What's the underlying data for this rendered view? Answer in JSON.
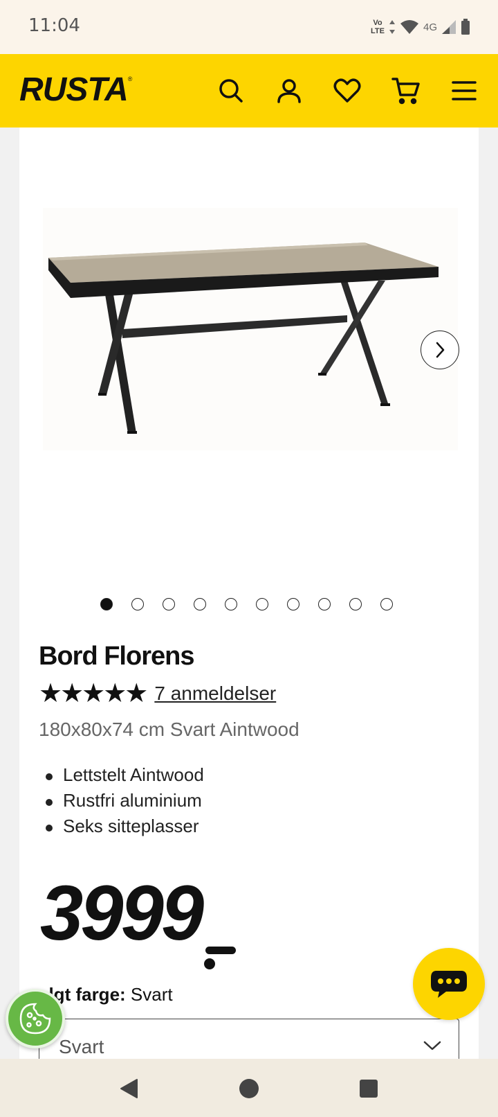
{
  "status_bar": {
    "time": "11:04",
    "volte": "Vo LTE",
    "network": "4G",
    "icons": [
      "volte-icon",
      "data-arrows-icon",
      "wifi-icon",
      "signal-icon",
      "battery-icon"
    ]
  },
  "header": {
    "logo": "RUSTA",
    "logo_mark": "®",
    "background": "#fdd500",
    "icons": [
      "search-icon",
      "account-icon",
      "heart-icon",
      "cart-icon",
      "menu-icon"
    ]
  },
  "carousel": {
    "total_images": 10,
    "active_index": 0,
    "next_icon": "chevron-right-icon"
  },
  "product": {
    "title": "Bord Florens",
    "stars": "★★★★★",
    "rating": 5,
    "reviews_link": "7 anmeldelser",
    "subtitle": "180x80x74 cm Svart Aintwood",
    "features": [
      "Lettstelt Aintwood",
      "Rustfri aluminium",
      "Seks sitteplasser"
    ],
    "price": "3999"
  },
  "color_select": {
    "label_prefix": "algt farge:",
    "label_value": "Svart",
    "selected": "Svart"
  },
  "fabs": {
    "chat_icon": "chat-bubble-icon",
    "cookie_icon": "cookie-icon"
  },
  "nav": [
    "back-icon",
    "home-icon",
    "recents-icon"
  ]
}
